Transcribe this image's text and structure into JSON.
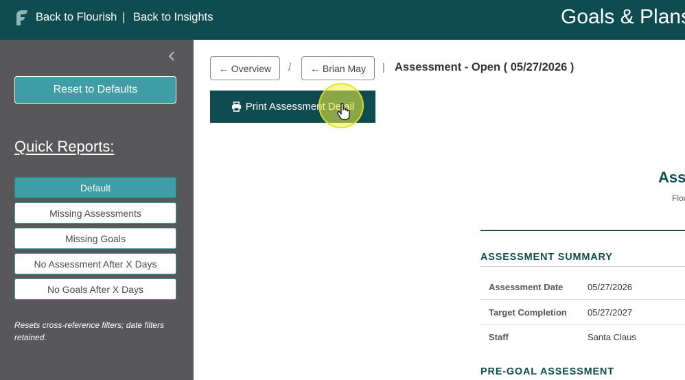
{
  "topbar": {
    "back_flourish": "Back to Flourish",
    "separator": "|",
    "back_insights": "Back to Insights",
    "app_title": "Goals & Plans"
  },
  "sidebar": {
    "reset_label": "Reset to Defaults",
    "quick_reports_title": "Quick Reports:",
    "quick_reports": [
      {
        "label": "Default",
        "active": true
      },
      {
        "label": "Missing Assessments",
        "active": false
      },
      {
        "label": "Missing Goals",
        "active": false
      },
      {
        "label": "No Assessment After X Days",
        "active": false
      },
      {
        "label": "No Goals After X Days",
        "active": false
      }
    ],
    "note": "Resets cross-reference filters; date filters retained."
  },
  "breadcrumb": {
    "overview_label": "← Overview",
    "slash": "/",
    "student_label": "← Brian May",
    "pipe": "|",
    "title": "Assessment - Open ( 05/27/2026 )"
  },
  "print_button": {
    "label": "Print Assessment Detail",
    "icon": "printer-icon"
  },
  "document": {
    "title": "Ass",
    "subtitle": "Flou",
    "summary_heading": "ASSESSMENT SUMMARY",
    "summary_rows": [
      {
        "label": "Assessment Date",
        "value": "05/27/2026"
      },
      {
        "label": "Target Completion",
        "value": "05/27/2027"
      },
      {
        "label": "Staff",
        "value": "Santa Claus"
      }
    ],
    "pre_goal_heading": "PRE-GOAL ASSESSMENT"
  },
  "colors": {
    "brand_dark": "#0f4c52",
    "accent_teal": "#3f9da5",
    "sidebar_bg": "#58585a"
  }
}
